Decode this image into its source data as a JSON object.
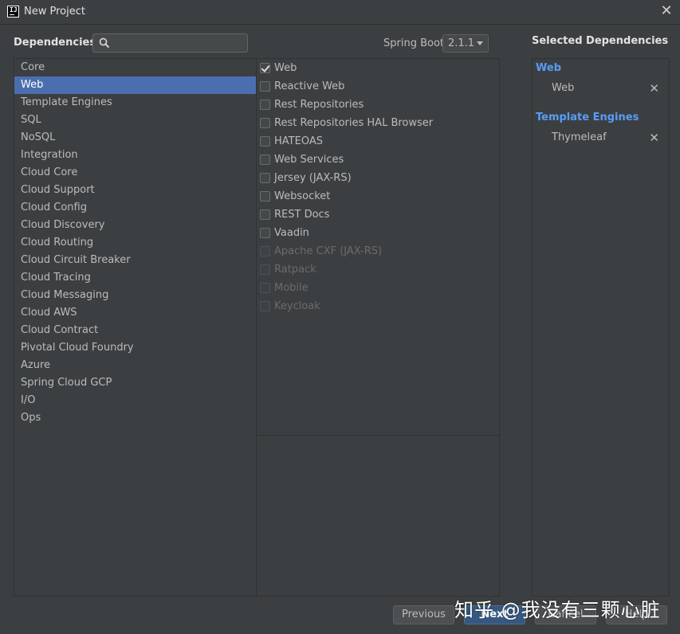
{
  "window": {
    "title": "New Project",
    "app_icon_text": "IJ"
  },
  "header": {
    "dependencies_label": "Dependencies",
    "search_placeholder": "",
    "spring_boot_label": "Spring Boot",
    "spring_boot_version": "2.1.1"
  },
  "categories": [
    {
      "label": "Core",
      "selected": false
    },
    {
      "label": "Web",
      "selected": true
    },
    {
      "label": "Template Engines",
      "selected": false
    },
    {
      "label": "SQL",
      "selected": false
    },
    {
      "label": "NoSQL",
      "selected": false
    },
    {
      "label": "Integration",
      "selected": false
    },
    {
      "label": "Cloud Core",
      "selected": false
    },
    {
      "label": "Cloud Support",
      "selected": false
    },
    {
      "label": "Cloud Config",
      "selected": false
    },
    {
      "label": "Cloud Discovery",
      "selected": false
    },
    {
      "label": "Cloud Routing",
      "selected": false
    },
    {
      "label": "Cloud Circuit Breaker",
      "selected": false
    },
    {
      "label": "Cloud Tracing",
      "selected": false
    },
    {
      "label": "Cloud Messaging",
      "selected": false
    },
    {
      "label": "Cloud AWS",
      "selected": false
    },
    {
      "label": "Cloud Contract",
      "selected": false
    },
    {
      "label": "Pivotal Cloud Foundry",
      "selected": false
    },
    {
      "label": "Azure",
      "selected": false
    },
    {
      "label": "Spring Cloud GCP",
      "selected": false
    },
    {
      "label": "I/O",
      "selected": false
    },
    {
      "label": "Ops",
      "selected": false
    }
  ],
  "dependencies": [
    {
      "label": "Web",
      "checked": true,
      "enabled": true
    },
    {
      "label": "Reactive Web",
      "checked": false,
      "enabled": true
    },
    {
      "label": "Rest Repositories",
      "checked": false,
      "enabled": true
    },
    {
      "label": "Rest Repositories HAL Browser",
      "checked": false,
      "enabled": true
    },
    {
      "label": "HATEOAS",
      "checked": false,
      "enabled": true
    },
    {
      "label": "Web Services",
      "checked": false,
      "enabled": true
    },
    {
      "label": "Jersey (JAX-RS)",
      "checked": false,
      "enabled": true
    },
    {
      "label": "Websocket",
      "checked": false,
      "enabled": true
    },
    {
      "label": "REST Docs",
      "checked": false,
      "enabled": true
    },
    {
      "label": "Vaadin",
      "checked": false,
      "enabled": true
    },
    {
      "label": "Apache CXF (JAX-RS)",
      "checked": false,
      "enabled": false
    },
    {
      "label": "Ratpack",
      "checked": false,
      "enabled": false
    },
    {
      "label": "Mobile",
      "checked": false,
      "enabled": false
    },
    {
      "label": "Keycloak",
      "checked": false,
      "enabled": false
    }
  ],
  "selected": {
    "title": "Selected Dependencies",
    "groups": [
      {
        "name": "Web",
        "items": [
          "Web"
        ]
      },
      {
        "name": "Template Engines",
        "items": [
          "Thymeleaf"
        ]
      }
    ],
    "remove_glyph": "✕"
  },
  "buttons": {
    "previous": "Previous",
    "next": "Next",
    "cancel": "Cancel",
    "help": "Help"
  },
  "watermark": "知乎 @我没有三颗心脏",
  "colors": {
    "background": "#3c3f41",
    "selection": "#4b6eaf",
    "group_title": "#589df6",
    "primary_button": "#365880"
  }
}
